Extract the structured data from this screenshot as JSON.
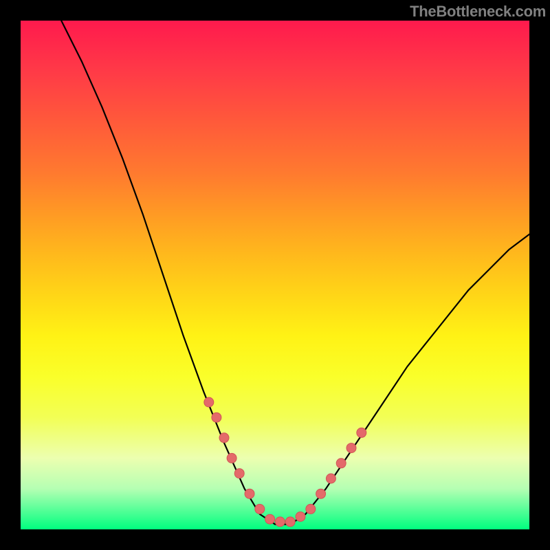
{
  "watermark": "TheBottleneck.com",
  "colors": {
    "gradient_top": "#ff1a4d",
    "gradient_bottom": "#00ff7f",
    "curve": "#000000",
    "dot_fill": "#e46a6a",
    "dot_stroke": "#d05555",
    "frame": "#000000",
    "watermark_text": "#808080"
  },
  "chart_data": {
    "type": "line",
    "title": "",
    "xlabel": "",
    "ylabel": "",
    "xlim": [
      0,
      100
    ],
    "ylim": [
      0,
      100
    ],
    "grid": false,
    "legend": false,
    "series": [
      {
        "name": "curve",
        "points": [
          {
            "x": 8,
            "y": 100
          },
          {
            "x": 12,
            "y": 92
          },
          {
            "x": 16,
            "y": 83
          },
          {
            "x": 20,
            "y": 73
          },
          {
            "x": 24,
            "y": 62
          },
          {
            "x": 28,
            "y": 50
          },
          {
            "x": 32,
            "y": 38
          },
          {
            "x": 36,
            "y": 27
          },
          {
            "x": 40,
            "y": 17
          },
          {
            "x": 44,
            "y": 8
          },
          {
            "x": 47,
            "y": 3
          },
          {
            "x": 50,
            "y": 1
          },
          {
            "x": 53,
            "y": 1
          },
          {
            "x": 56,
            "y": 3
          },
          {
            "x": 60,
            "y": 8
          },
          {
            "x": 64,
            "y": 14
          },
          {
            "x": 68,
            "y": 20
          },
          {
            "x": 72,
            "y": 26
          },
          {
            "x": 76,
            "y": 32
          },
          {
            "x": 80,
            "y": 37
          },
          {
            "x": 84,
            "y": 42
          },
          {
            "x": 88,
            "y": 47
          },
          {
            "x": 92,
            "y": 51
          },
          {
            "x": 96,
            "y": 55
          },
          {
            "x": 100,
            "y": 58
          }
        ]
      }
    ],
    "highlight_points": [
      {
        "x": 37,
        "y": 25
      },
      {
        "x": 38.5,
        "y": 22
      },
      {
        "x": 40,
        "y": 18
      },
      {
        "x": 41.5,
        "y": 14
      },
      {
        "x": 43,
        "y": 11
      },
      {
        "x": 45,
        "y": 7
      },
      {
        "x": 47,
        "y": 4
      },
      {
        "x": 49,
        "y": 2
      },
      {
        "x": 51,
        "y": 1.5
      },
      {
        "x": 53,
        "y": 1.5
      },
      {
        "x": 55,
        "y": 2.5
      },
      {
        "x": 57,
        "y": 4
      },
      {
        "x": 59,
        "y": 7
      },
      {
        "x": 61,
        "y": 10
      },
      {
        "x": 63,
        "y": 13
      },
      {
        "x": 65,
        "y": 16
      },
      {
        "x": 67,
        "y": 19
      }
    ]
  }
}
